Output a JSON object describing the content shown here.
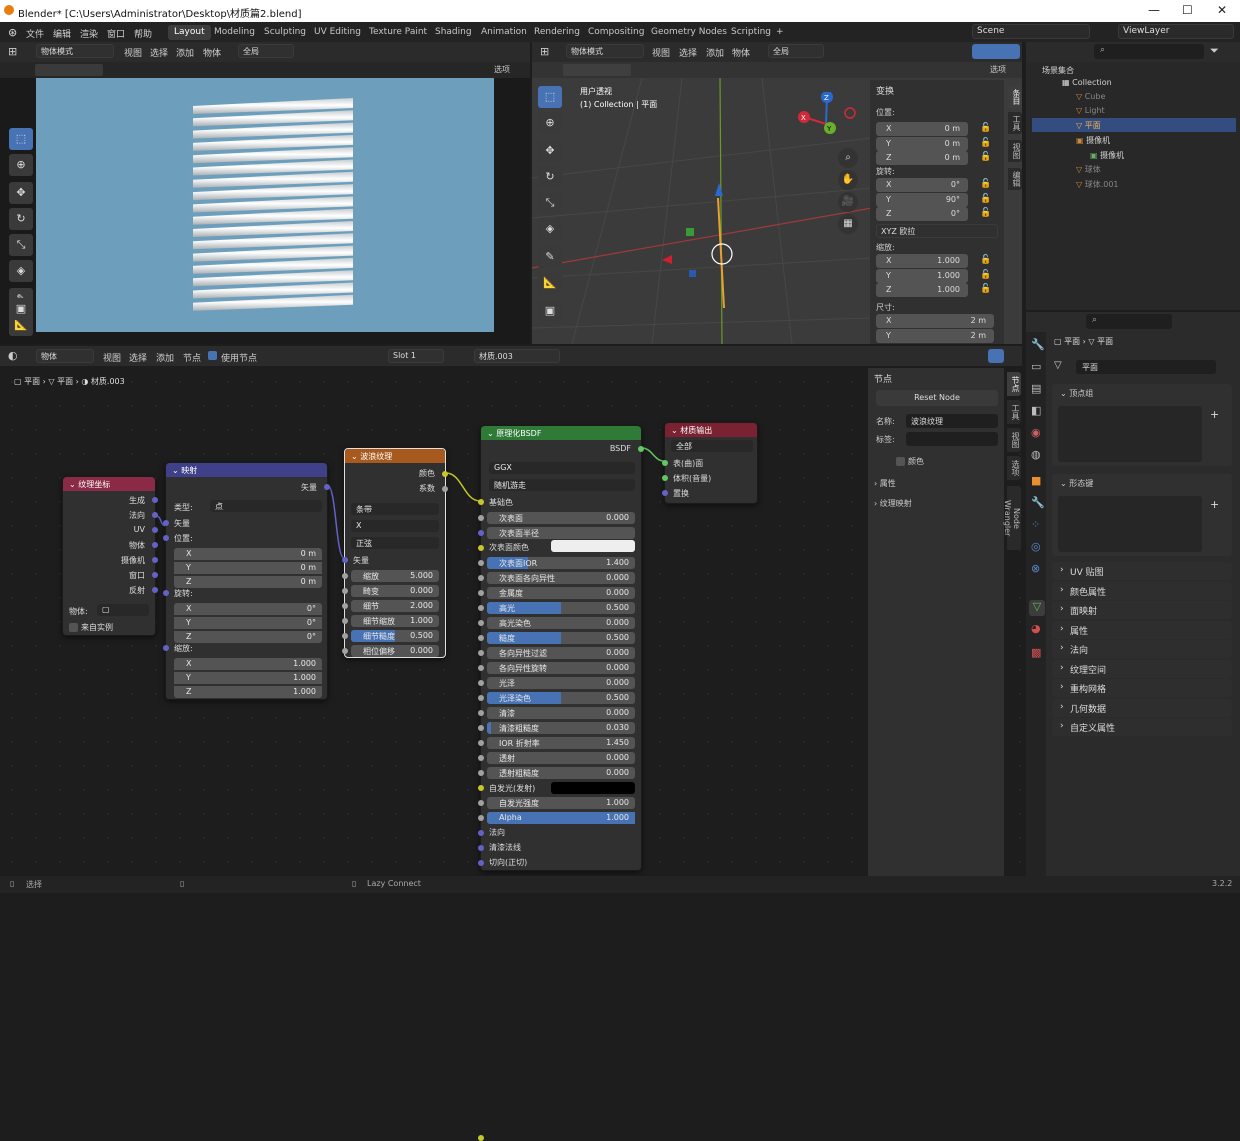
{
  "window": {
    "title": "Blender* [C:\\Users\\Administrator\\Desktop\\材质篇2.blend]",
    "min": "—",
    "max": "☐",
    "close": "✕"
  },
  "menu": [
    "文件",
    "编辑",
    "渲染",
    "窗口",
    "帮助"
  ],
  "workspaces": [
    "Layout",
    "Modeling",
    "Sculpting",
    "UV Editing",
    "Texture Paint",
    "Shading",
    "Animation",
    "Rendering",
    "Compositing",
    "Geometry Nodes",
    "Scripting",
    "+"
  ],
  "scene": "Scene",
  "viewlayer": "ViewLayer",
  "vp_left": {
    "mode": "物体模式",
    "menus": [
      "视图",
      "选择",
      "添加",
      "物体"
    ],
    "orient": "全局",
    "options": "选项"
  },
  "vp_right": {
    "mode": "物体模式",
    "menus": [
      "视图",
      "选择",
      "添加",
      "物体"
    ],
    "orient": "全局",
    "options": "选项",
    "title": "用户透视",
    "subtitle": "(1) Collection | 平面"
  },
  "transform": {
    "title": "变换",
    "loc": "位置:",
    "rot": "旋转:",
    "scale": "缩放:",
    "dim": "尺寸:",
    "axes": [
      "X",
      "Y",
      "Z"
    ],
    "loc_v": [
      "0 m",
      "0 m",
      "0 m"
    ],
    "rot_v": [
      "0°",
      "90°",
      "0°"
    ],
    "euler": "XYZ 欧拉",
    "scale_v": [
      "1.000",
      "1.000",
      "1.000"
    ],
    "dim_v": [
      "2 m",
      "2 m"
    ]
  },
  "vtabs_top": [
    "条目",
    "工具",
    "视图",
    "编辑"
  ],
  "outliner": {
    "title": "场景集合",
    "collection": "Collection",
    "items": [
      "Cube",
      "Light",
      "平面",
      "摄像机",
      "摄像机",
      "球体",
      "球体.001"
    ]
  },
  "node_editor": {
    "type": "物体",
    "menus": [
      "视图",
      "选择",
      "添加",
      "节点"
    ],
    "use_nodes": "使用节点",
    "slot": "Slot 1",
    "material": "材质.003",
    "crumb": [
      "平面",
      "平面",
      "材质.003"
    ]
  },
  "nodes": {
    "texcoord": {
      "title": "纹理坐标",
      "outs": [
        "生成",
        "法向",
        "UV",
        "物体",
        "摄像机",
        "窗口",
        "反射"
      ],
      "obj": "物体:",
      "inst": "来自实例"
    },
    "mapping": {
      "title": "映射",
      "out": "矢量",
      "type_l": "类型:",
      "type_v": "点",
      "vec": "矢量",
      "pos": "位置:",
      "rot": "旋转:",
      "scl": "缩放:",
      "axes": [
        "X",
        "Y",
        "Z"
      ],
      "pos_v": [
        "0 m",
        "0 m",
        "0 m"
      ],
      "rot_v": [
        "0°",
        "0°",
        "0°"
      ],
      "scl_v": [
        "1.000",
        "1.000",
        "1.000"
      ]
    },
    "wave": {
      "title": "波浪纹理",
      "outs": [
        "颜色",
        "系数"
      ],
      "d1": "条带",
      "d2": "X",
      "d3": "正弦",
      "vec": "矢量",
      "f": [
        [
          "缩放",
          "5.000"
        ],
        [
          "畸变",
          "0.000"
        ],
        [
          "细节",
          "2.000"
        ],
        [
          "细节缩放",
          "1.000"
        ],
        [
          "细节糙度",
          "0.500"
        ],
        [
          "相位偏移",
          "0.000"
        ]
      ]
    },
    "bsdf": {
      "title": "原理化BSDF",
      "out": "BSDF",
      "d1": "GGX",
      "d2": "随机游走",
      "base": "基础色",
      "f1": [
        "次表面",
        "0.000"
      ],
      "sub_r": "次表面半径",
      "sub_c": "次表面颜色",
      "f": [
        [
          "次表面IOR",
          "1.400"
        ],
        [
          "次表面各向异性",
          "0.000"
        ],
        [
          "金属度",
          "0.000"
        ],
        [
          "高光",
          "0.500"
        ],
        [
          "高光染色",
          "0.000"
        ],
        [
          "糙度",
          "0.500"
        ],
        [
          "各向异性过滤",
          "0.000"
        ],
        [
          "各向异性旋转",
          "0.000"
        ],
        [
          "光泽",
          "0.000"
        ],
        [
          "光泽染色",
          "0.500"
        ],
        [
          "清漆",
          "0.000"
        ],
        [
          "清漆粗糙度",
          "0.030"
        ],
        [
          "IOR 折射率",
          "1.450"
        ],
        [
          "透射",
          "0.000"
        ],
        [
          "透射粗糙度",
          "0.000"
        ]
      ],
      "emit": "自发光(发射)",
      "emit_s": [
        "自发光强度",
        "1.000"
      ],
      "alpha": [
        "Alpha",
        "1.000"
      ],
      "ins": [
        "法向",
        "清漆法线",
        "切向(正切)"
      ]
    },
    "output": {
      "title": "材质输出",
      "target": "全部",
      "ins": [
        "表(曲)面",
        "体积(音量)",
        "置换"
      ]
    }
  },
  "npanel": {
    "title": "节点",
    "reset": "Reset Node",
    "name_l": "名称:",
    "name_v": "波浪纹理",
    "label_l": "标签:",
    "color": "颜色",
    "props": "属性",
    "texmap": "纹理映射"
  },
  "vtabs_node": [
    "节点",
    "工具",
    "视图",
    "选项",
    "Node Wrangler"
  ],
  "props": {
    "crumb": [
      "平面",
      "平面"
    ],
    "mesh": "平面",
    "sections": [
      "顶点组",
      "形态键",
      "UV 贴图",
      "颜色属性",
      "面映射",
      "属性",
      "法向",
      "纹理空间",
      "重构网格",
      "几何数据",
      "自定义属性"
    ]
  },
  "status": {
    "left": "选择",
    "mid": "Lazy Connect",
    "version": "3.2.2"
  }
}
